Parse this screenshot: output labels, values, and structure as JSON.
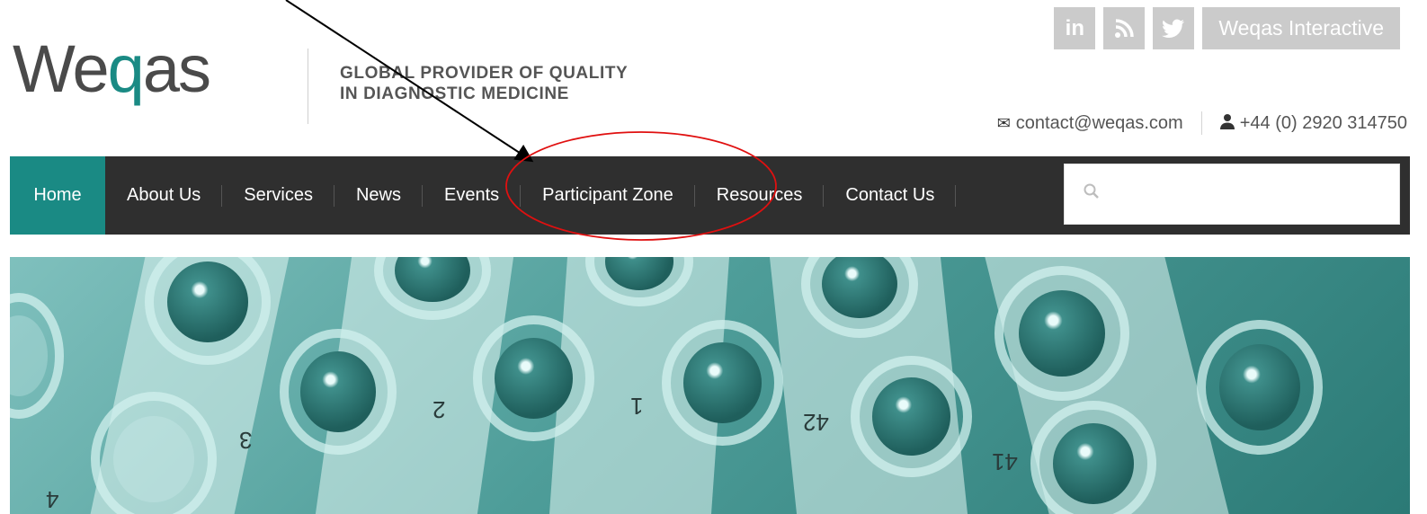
{
  "brand": {
    "logo_text_a": "We",
    "logo_text_q": "q",
    "logo_text_b": "as",
    "tagline_line1": "GLOBAL PROVIDER OF QUALITY",
    "tagline_line2": "IN DIAGNOSTIC MEDICINE"
  },
  "social": {
    "linkedin": "in",
    "rss_icon": "rss-icon",
    "twitter_icon": "twitter-icon",
    "interactive_label": "Weqas Interactive"
  },
  "contact": {
    "email": "contact@weqas.com",
    "phone": "+44 (0) 2920 314750"
  },
  "nav": {
    "items": [
      {
        "label": "Home"
      },
      {
        "label": "About Us"
      },
      {
        "label": "Services"
      },
      {
        "label": "News"
      },
      {
        "label": "Events"
      },
      {
        "label": "Participant Zone"
      },
      {
        "label": "Resources"
      },
      {
        "label": "Contact Us"
      }
    ],
    "search_placeholder": ""
  },
  "banner": {
    "tube_labels": [
      "3",
      "2",
      "1",
      "42",
      "41",
      "4"
    ]
  },
  "colors": {
    "accent": "#1a8a84",
    "nav_bg": "#2f2f2f",
    "social_bg": "#cbcbcb",
    "annotation_red": "#e01010"
  }
}
